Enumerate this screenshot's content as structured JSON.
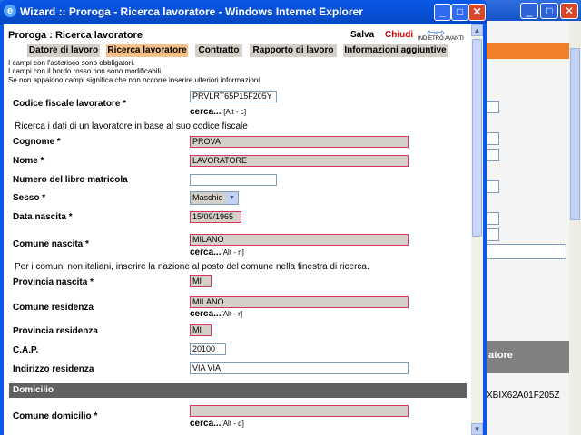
{
  "window": {
    "title": "Wizard :: Proroga - Ricerca lavoratore - Windows Internet Explorer",
    "icon_glyph": "e"
  },
  "header": {
    "title": "Proroga : Ricerca lavoratore",
    "save_label": "Salva",
    "close_label": "Chiudi",
    "nav_label": "INDIETRO AVANTI",
    "nav_arrows": "⇦⇨"
  },
  "tabs": [
    {
      "label": "Datore di lavoro",
      "active": false
    },
    {
      "label": "Ricerca lavoratore",
      "active": true
    },
    {
      "label": "Contratto",
      "active": false
    },
    {
      "label": "Rapporto di lavoro",
      "active": false
    },
    {
      "label": "Informazioni aggiuntive",
      "active": false
    }
  ],
  "notes": [
    "I campi con l'asterisco sono obbligatori.",
    "I campi con il bordo rosso non sono modificabili.",
    "Se non appaiono campi significa che non occorre inserire ulteriori informazioni."
  ],
  "form": {
    "codice_fiscale": {
      "label": "Codice fiscale lavoratore *",
      "value": "PRVLRT65P15F205Y"
    },
    "cerca_cf": {
      "label": "cerca...",
      "shortcut": "[Alt - c]"
    },
    "cf_hint": "Ricerca i dati di un lavoratore in base al suo codice fiscale",
    "cognome": {
      "label": "Cognome *",
      "value": "PROVA"
    },
    "nome": {
      "label": "Nome *",
      "value": "LAVORATORE"
    },
    "libro_matricola": {
      "label": "Numero del libro matricola",
      "value": ""
    },
    "sesso": {
      "label": "Sesso *",
      "value": "Maschio"
    },
    "data_nascita": {
      "label": "Data nascita *",
      "value": "15/09/1965"
    },
    "comune_nascita": {
      "label": "Comune nascita *",
      "value": "MILANO"
    },
    "cerca_nascita": {
      "label": "cerca...",
      "shortcut": "[Alt - n]"
    },
    "comune_hint": "Per i comuni non italiani, inserire la nazione al posto del comune nella finestra di ricerca.",
    "provincia_nascita": {
      "label": "Provincia nascita *",
      "value": "MI"
    },
    "comune_residenza": {
      "label": "Comune residenza",
      "value": "MILANO"
    },
    "cerca_residenza": {
      "label": "cerca...",
      "shortcut": "[Alt - r]"
    },
    "provincia_residenza": {
      "label": "Provincia residenza",
      "value": "MI"
    },
    "cap": {
      "label": "C.A.P.",
      "value": "20100"
    },
    "indirizzo_residenza": {
      "label": "Indirizzo residenza",
      "value": "VIA VIA"
    },
    "domicilio_section": "Domicilio",
    "comune_domicilio": {
      "label": "Comune domicilio *",
      "value": ""
    },
    "cerca_domicilio": {
      "label": "cerca...",
      "shortcut": "[Alt - d]"
    }
  },
  "background": {
    "right_header": "atore",
    "right_code": "XBIX62A01F205Z"
  },
  "icons": {
    "minimize": "_",
    "maximize": "□",
    "close": "✕",
    "scroll_up": "▲",
    "scroll_down": "▼",
    "dropdown": "▼"
  }
}
